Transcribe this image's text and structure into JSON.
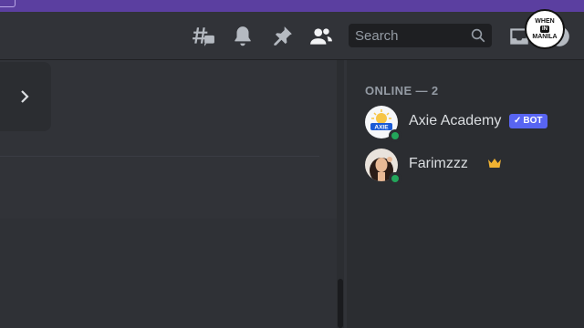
{
  "header": {
    "search_placeholder": "Search",
    "icons": [
      "threads-icon",
      "bell-icon",
      "pin-icon",
      "members-icon",
      "search-icon",
      "inbox-icon",
      "help-icon"
    ]
  },
  "watermark": {
    "line1": "WHEN",
    "line2": "IN",
    "line3": "MANILA"
  },
  "members": {
    "section_title": "ONLINE — 2",
    "list": [
      {
        "name": "Axie Academy",
        "tag": "BOT",
        "status": "online",
        "avatar_text": "AXIE"
      },
      {
        "name": "Farimzzz",
        "status": "online",
        "icon": "crown-icon"
      }
    ]
  },
  "colors": {
    "accent": "#5865f2",
    "online": "#23a55a",
    "crown": "#f0b232",
    "top_strip": "#5b3fa0"
  }
}
